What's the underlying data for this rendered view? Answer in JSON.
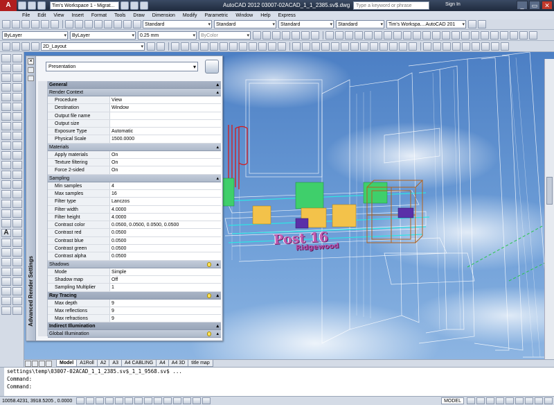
{
  "titlebar": {
    "app_logo": "A",
    "workspace": "Tim's Workspace 1 - Migrat...",
    "title": "AutoCAD 2012    03007-02ACAD_1_1_2385.sv$.dwg",
    "search_placeholder": "Type a keyword or phrase",
    "signin": "Sign In",
    "window_buttons": [
      "_",
      "▭",
      "✕"
    ]
  },
  "menu": [
    "File",
    "Edit",
    "View",
    "Insert",
    "Format",
    "Tools",
    "Draw",
    "Dimension",
    "Modify",
    "Parametric",
    "Window",
    "Help",
    "Express"
  ],
  "toolbar1": {
    "text_style": "Standard",
    "dim_style": "Standard",
    "table_style": "Standard",
    "mleader_style": "Standard",
    "workspace": "Tim's Workspa....AutoCAD 201"
  },
  "toolbar2": {
    "layer": "ByLayer",
    "linetype": "ByLayer",
    "lineweight": "0.25 mm",
    "color": "ByColor"
  },
  "toolbar3": {
    "view": "2D_Layout"
  },
  "palette": {
    "title": "Advanced Render Settings",
    "preset": "Presentation",
    "close_glyph": "✕",
    "sections": [
      {
        "name": "General",
        "major": true,
        "rows": []
      },
      {
        "name": "Render Context",
        "major": false,
        "rows": [
          {
            "k": "Procedure",
            "v": "View"
          },
          {
            "k": "Destination",
            "v": "Window"
          },
          {
            "k": "Output file name",
            "v": ""
          },
          {
            "k": "Output size",
            "v": ""
          },
          {
            "k": "Exposure Type",
            "v": "Automatic"
          },
          {
            "k": "Physical Scale",
            "v": "1500.0000"
          }
        ]
      },
      {
        "name": "Materials",
        "major": false,
        "rows": [
          {
            "k": "Apply materials",
            "v": "On"
          },
          {
            "k": "Texture filtering",
            "v": "On"
          },
          {
            "k": "Force 2-sided",
            "v": "On"
          }
        ]
      },
      {
        "name": "Sampling",
        "major": false,
        "rows": [
          {
            "k": "Min samples",
            "v": "4"
          },
          {
            "k": "Max samples",
            "v": "16"
          },
          {
            "k": "Filter type",
            "v": "Lanczos"
          },
          {
            "k": "Filter width",
            "v": "4.0000"
          },
          {
            "k": "Filter height",
            "v": "4.0000"
          },
          {
            "k": "Contrast color",
            "v": "0.0500, 0.0500, 0.0500, 0.0500"
          },
          {
            "k": "Contrast red",
            "v": "0.0500"
          },
          {
            "k": "Contrast blue",
            "v": "0.0500"
          },
          {
            "k": "Contrast green",
            "v": "0.0500"
          },
          {
            "k": "Contrast alpha",
            "v": "0.0500"
          }
        ]
      },
      {
        "name": "Shadows",
        "major": false,
        "rows": [
          {
            "k": "Mode",
            "v": "Simple"
          },
          {
            "k": "Shadow map",
            "v": "Off"
          },
          {
            "k": "Sampling Multiplier",
            "v": "1"
          }
        ]
      },
      {
        "name": "Ray Tracing",
        "major": true,
        "rows": [
          {
            "k": "Max depth",
            "v": "9"
          },
          {
            "k": "Max reflections",
            "v": "9"
          },
          {
            "k": "Max refractions",
            "v": "9"
          }
        ]
      },
      {
        "name": "Indirect Illumination",
        "major": true,
        "rows": []
      },
      {
        "name": "Global Illumination",
        "major": false,
        "rows": []
      }
    ]
  },
  "viewport": {
    "sign_line1": "Post 16",
    "sign_line2": "Ridgewood"
  },
  "tabs": [
    "Model",
    "A1Roll",
    "A2",
    "A3",
    "A4 CABLING",
    "A4",
    "A4 3D",
    "title map"
  ],
  "command": {
    "history1": "settings\\temp\\03007-02ACAD_1_1_2385.sv$_1_1_9568.sv$ ...",
    "history2": "Command:",
    "prompt": "Command:"
  },
  "status": {
    "coords": "10058.4231, 3918.5205 , 0.0000",
    "space": "MODEL"
  }
}
